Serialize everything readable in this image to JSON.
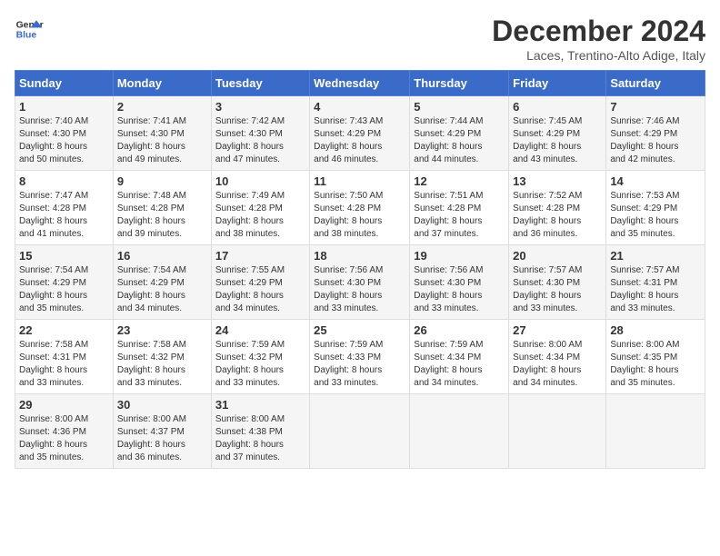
{
  "logo": {
    "line1": "General",
    "line2": "Blue"
  },
  "title": "December 2024",
  "subtitle": "Laces, Trentino-Alto Adige, Italy",
  "days_of_week": [
    "Sunday",
    "Monday",
    "Tuesday",
    "Wednesday",
    "Thursday",
    "Friday",
    "Saturday"
  ],
  "weeks": [
    [
      {
        "day": 1,
        "lines": [
          "Sunrise: 7:40 AM",
          "Sunset: 4:30 PM",
          "Daylight: 8 hours",
          "and 50 minutes."
        ]
      },
      {
        "day": 2,
        "lines": [
          "Sunrise: 7:41 AM",
          "Sunset: 4:30 PM",
          "Daylight: 8 hours",
          "and 49 minutes."
        ]
      },
      {
        "day": 3,
        "lines": [
          "Sunrise: 7:42 AM",
          "Sunset: 4:30 PM",
          "Daylight: 8 hours",
          "and 47 minutes."
        ]
      },
      {
        "day": 4,
        "lines": [
          "Sunrise: 7:43 AM",
          "Sunset: 4:29 PM",
          "Daylight: 8 hours",
          "and 46 minutes."
        ]
      },
      {
        "day": 5,
        "lines": [
          "Sunrise: 7:44 AM",
          "Sunset: 4:29 PM",
          "Daylight: 8 hours",
          "and 44 minutes."
        ]
      },
      {
        "day": 6,
        "lines": [
          "Sunrise: 7:45 AM",
          "Sunset: 4:29 PM",
          "Daylight: 8 hours",
          "and 43 minutes."
        ]
      },
      {
        "day": 7,
        "lines": [
          "Sunrise: 7:46 AM",
          "Sunset: 4:29 PM",
          "Daylight: 8 hours",
          "and 42 minutes."
        ]
      }
    ],
    [
      {
        "day": 8,
        "lines": [
          "Sunrise: 7:47 AM",
          "Sunset: 4:28 PM",
          "Daylight: 8 hours",
          "and 41 minutes."
        ]
      },
      {
        "day": 9,
        "lines": [
          "Sunrise: 7:48 AM",
          "Sunset: 4:28 PM",
          "Daylight: 8 hours",
          "and 39 minutes."
        ]
      },
      {
        "day": 10,
        "lines": [
          "Sunrise: 7:49 AM",
          "Sunset: 4:28 PM",
          "Daylight: 8 hours",
          "and 38 minutes."
        ]
      },
      {
        "day": 11,
        "lines": [
          "Sunrise: 7:50 AM",
          "Sunset: 4:28 PM",
          "Daylight: 8 hours",
          "and 38 minutes."
        ]
      },
      {
        "day": 12,
        "lines": [
          "Sunrise: 7:51 AM",
          "Sunset: 4:28 PM",
          "Daylight: 8 hours",
          "and 37 minutes."
        ]
      },
      {
        "day": 13,
        "lines": [
          "Sunrise: 7:52 AM",
          "Sunset: 4:28 PM",
          "Daylight: 8 hours",
          "and 36 minutes."
        ]
      },
      {
        "day": 14,
        "lines": [
          "Sunrise: 7:53 AM",
          "Sunset: 4:29 PM",
          "Daylight: 8 hours",
          "and 35 minutes."
        ]
      }
    ],
    [
      {
        "day": 15,
        "lines": [
          "Sunrise: 7:54 AM",
          "Sunset: 4:29 PM",
          "Daylight: 8 hours",
          "and 35 minutes."
        ]
      },
      {
        "day": 16,
        "lines": [
          "Sunrise: 7:54 AM",
          "Sunset: 4:29 PM",
          "Daylight: 8 hours",
          "and 34 minutes."
        ]
      },
      {
        "day": 17,
        "lines": [
          "Sunrise: 7:55 AM",
          "Sunset: 4:29 PM",
          "Daylight: 8 hours",
          "and 34 minutes."
        ]
      },
      {
        "day": 18,
        "lines": [
          "Sunrise: 7:56 AM",
          "Sunset: 4:30 PM",
          "Daylight: 8 hours",
          "and 33 minutes."
        ]
      },
      {
        "day": 19,
        "lines": [
          "Sunrise: 7:56 AM",
          "Sunset: 4:30 PM",
          "Daylight: 8 hours",
          "and 33 minutes."
        ]
      },
      {
        "day": 20,
        "lines": [
          "Sunrise: 7:57 AM",
          "Sunset: 4:30 PM",
          "Daylight: 8 hours",
          "and 33 minutes."
        ]
      },
      {
        "day": 21,
        "lines": [
          "Sunrise: 7:57 AM",
          "Sunset: 4:31 PM",
          "Daylight: 8 hours",
          "and 33 minutes."
        ]
      }
    ],
    [
      {
        "day": 22,
        "lines": [
          "Sunrise: 7:58 AM",
          "Sunset: 4:31 PM",
          "Daylight: 8 hours",
          "and 33 minutes."
        ]
      },
      {
        "day": 23,
        "lines": [
          "Sunrise: 7:58 AM",
          "Sunset: 4:32 PM",
          "Daylight: 8 hours",
          "and 33 minutes."
        ]
      },
      {
        "day": 24,
        "lines": [
          "Sunrise: 7:59 AM",
          "Sunset: 4:32 PM",
          "Daylight: 8 hours",
          "and 33 minutes."
        ]
      },
      {
        "day": 25,
        "lines": [
          "Sunrise: 7:59 AM",
          "Sunset: 4:33 PM",
          "Daylight: 8 hours",
          "and 33 minutes."
        ]
      },
      {
        "day": 26,
        "lines": [
          "Sunrise: 7:59 AM",
          "Sunset: 4:34 PM",
          "Daylight: 8 hours",
          "and 34 minutes."
        ]
      },
      {
        "day": 27,
        "lines": [
          "Sunrise: 8:00 AM",
          "Sunset: 4:34 PM",
          "Daylight: 8 hours",
          "and 34 minutes."
        ]
      },
      {
        "day": 28,
        "lines": [
          "Sunrise: 8:00 AM",
          "Sunset: 4:35 PM",
          "Daylight: 8 hours",
          "and 35 minutes."
        ]
      }
    ],
    [
      {
        "day": 29,
        "lines": [
          "Sunrise: 8:00 AM",
          "Sunset: 4:36 PM",
          "Daylight: 8 hours",
          "and 35 minutes."
        ]
      },
      {
        "day": 30,
        "lines": [
          "Sunrise: 8:00 AM",
          "Sunset: 4:37 PM",
          "Daylight: 8 hours",
          "and 36 minutes."
        ]
      },
      {
        "day": 31,
        "lines": [
          "Sunrise: 8:00 AM",
          "Sunset: 4:38 PM",
          "Daylight: 8 hours",
          "and 37 minutes."
        ]
      },
      null,
      null,
      null,
      null
    ]
  ]
}
